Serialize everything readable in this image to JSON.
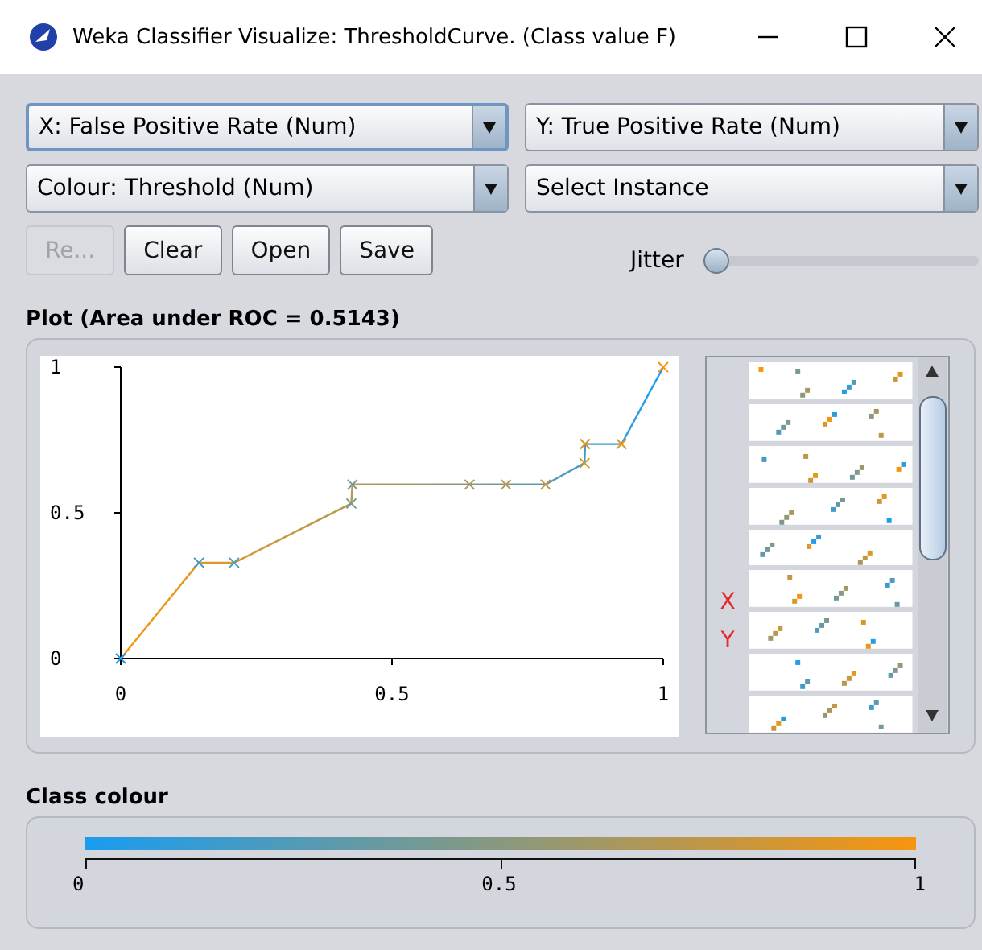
{
  "window": {
    "title": "Weka Classifier Visualize: ThresholdCurve. (Class value F)"
  },
  "selectors": [
    {
      "value": "X: False Positive Rate (Num)",
      "focused": true
    },
    {
      "value": "Y: True Positive Rate (Num)",
      "focused": false
    },
    {
      "value": "Colour: Threshold (Num)",
      "focused": false
    },
    {
      "value": "Select Instance",
      "focused": false
    }
  ],
  "buttons": [
    {
      "label": "Re...",
      "disabled": true
    },
    {
      "label": "Clear",
      "disabled": false
    },
    {
      "label": "Open",
      "disabled": false
    },
    {
      "label": "Save",
      "disabled": false
    }
  ],
  "jitter": {
    "label": "Jitter",
    "level": 0
  },
  "plot": {
    "title": "Plot (Area under ROC = 0.5143)",
    "chart_data": {
      "type": "line",
      "x": [
        0,
        0.144,
        0.209,
        0.425,
        0.427,
        0.643,
        0.71,
        0.783,
        0.855,
        0.856,
        0.923,
        1
      ],
      "series": [
        {
          "marker": "x",
          "values": [
            0,
            0.329,
            0.329,
            0.532,
            0.597,
            0.597,
            0.597,
            0.597,
            0.671,
            0.736,
            0.736,
            1
          ]
        }
      ],
      "xlim": [
        0,
        1
      ],
      "ylim": [
        0,
        1
      ],
      "xticks": [
        0,
        0.5,
        1
      ],
      "yticks": [
        0,
        0.5,
        1
      ]
    },
    "matrix": {
      "x_label": "X",
      "y_label": "Y"
    }
  },
  "class_colour": {
    "title": "Class colour",
    "ticks": [
      "0",
      "0.5",
      "1"
    ]
  }
}
